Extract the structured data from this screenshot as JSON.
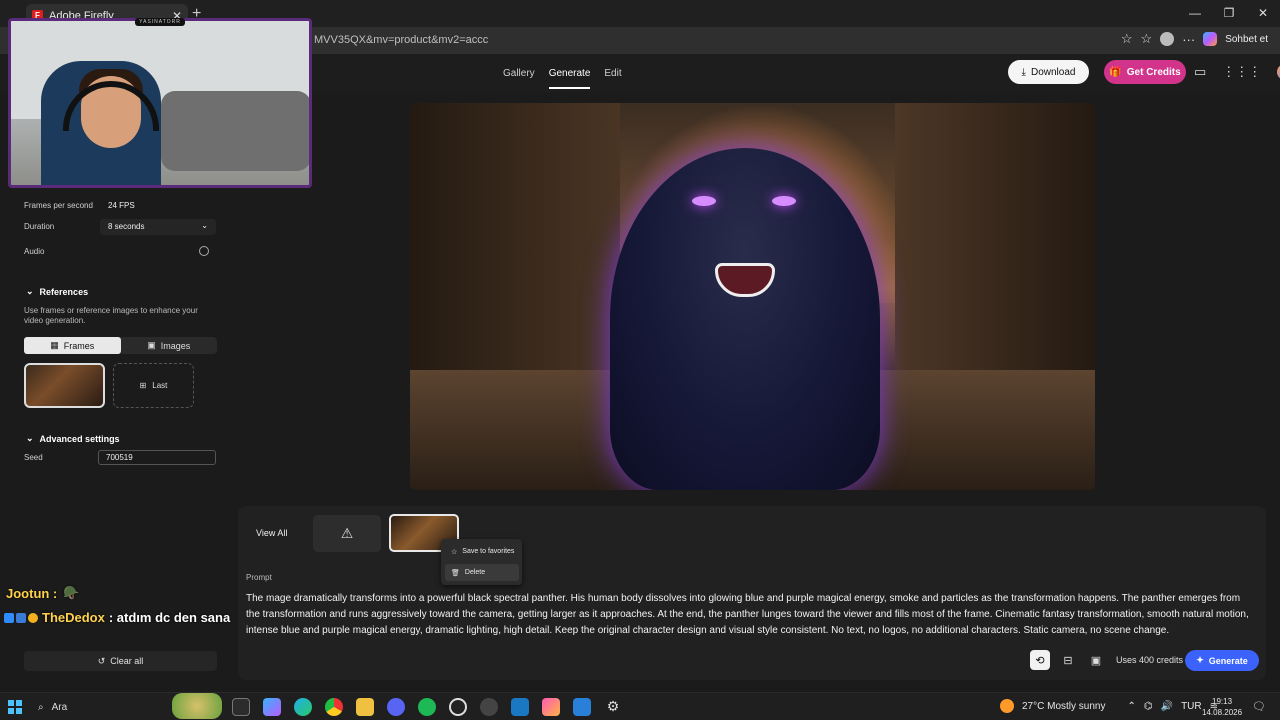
{
  "browser": {
    "tab_title": "Adobe Firefly",
    "url_fragment": "MVV35QX&mv=product&mv2=accc",
    "copilot_label": "Sohbet et"
  },
  "header": {
    "nav": [
      "Gallery",
      "Generate",
      "Edit"
    ],
    "active_nav": "Generate",
    "download_label": "Download",
    "credits_label": "Get Credits"
  },
  "sidebar": {
    "fps_label": "Frames per second",
    "fps_value": "24 FPS",
    "duration_label": "Duration",
    "duration_value": "8 seconds",
    "audio_label": "Audio",
    "references_title": "References",
    "references_desc": "Use frames or reference images to enhance your video generation.",
    "frames_tab": "Frames",
    "images_tab": "Images",
    "last_label": "Last",
    "advanced_title": "Advanced settings",
    "seed_label": "Seed",
    "seed_value": "700519",
    "clear_all": "Clear all"
  },
  "webcam": {
    "tag": "YASINATORR"
  },
  "chat": {
    "line1_name": "Jootun :",
    "line2_name": "TheDedox",
    "line2_text": ": atdım dc den sana"
  },
  "results": {
    "view_all": "View All",
    "context_menu": {
      "save": "Save to favorites",
      "delete": "Delete"
    }
  },
  "prompt": {
    "label": "Prompt",
    "text": "The mage dramatically transforms into a powerful black spectral panther. His human body dissolves into glowing blue and purple magical energy, smoke and particles as the transformation happens. The panther emerges from the transformation and runs aggressively toward the camera, getting larger as it approaches. At the end, the panther lunges toward the viewer and fills most of the frame. Cinematic fantasy transformation, smooth natural motion, intense blue and purple magical energy, dramatic lighting, high detail. Keep the original character design and visual style consistent. No text, no logos, no additional characters. Static camera, no scene change."
  },
  "generate": {
    "uses_credits": "Uses 400 credits",
    "button": "Generate"
  },
  "taskbar": {
    "search_placeholder": "Ara",
    "weather": "27°C  Mostly sunny",
    "language": "TUR",
    "time": "19:13",
    "date": "14.08.2026"
  },
  "colors": {
    "accent_generate": "#3b63fb",
    "accent_credits": "#d2348c",
    "panther_glow": "#7a3ad0"
  }
}
